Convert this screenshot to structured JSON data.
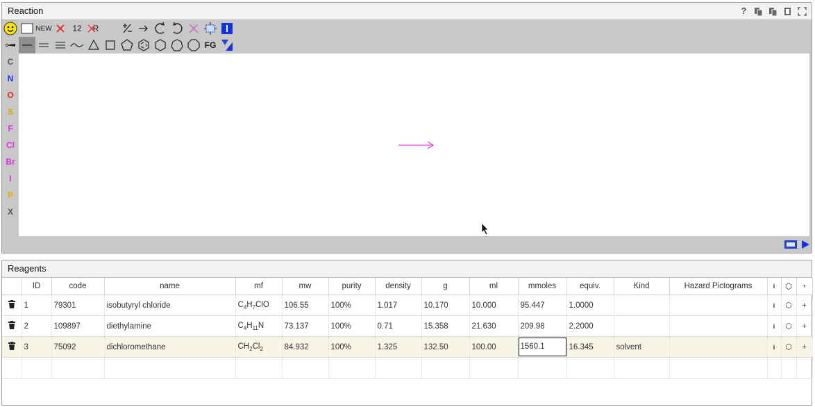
{
  "reaction_panel": {
    "title": "Reaction",
    "toolbar_row1": [
      "smiley",
      "blank",
      "NEW",
      "erase",
      "12",
      "R",
      "empty",
      "charge",
      "arrow",
      "rotate-ccw",
      "rotate-cw",
      "no-stereo",
      "select",
      "info"
    ],
    "new_label": "NEW",
    "num_label": "12",
    "rgroup_label": "R",
    "fg_label": "FG",
    "elements": [
      "C",
      "N",
      "O",
      "S",
      "F",
      "Cl",
      "Br",
      "I",
      "P",
      "X"
    ],
    "colors": {
      "C": "#555555",
      "N": "#2233ee",
      "O": "#ee2222",
      "S": "#c8b400",
      "F": "#dd33dd",
      "Cl": "#dd33dd",
      "Br": "#dd33dd",
      "I": "#dd33dd",
      "P": "#f0b000",
      "X": "#555555",
      "arrow": "#e040e0"
    }
  },
  "reagents_panel": {
    "title": "Reagents",
    "columns": [
      "",
      "ID",
      "code",
      "name",
      "mf",
      "mw",
      "purity",
      "density",
      "g",
      "ml",
      "mmoles",
      "equiv.",
      "Kind",
      "Hazard Pictograms",
      "i",
      "⬡",
      "+"
    ],
    "rows": [
      {
        "id": "1",
        "code": "79301",
        "name": "isobutyryl chloride",
        "mf": [
          "C",
          "4",
          "H",
          "7",
          "ClO"
        ],
        "mw": "106.55",
        "purity": "100%",
        "density": "1.017",
        "g": "10.170",
        "ml": "10.000",
        "mmoles": "95.447",
        "equiv": "1.0000",
        "kind": ""
      },
      {
        "id": "2",
        "code": "109897",
        "name": "diethylamine",
        "mf": [
          "C",
          "4",
          "H",
          "11",
          "N"
        ],
        "mw": "73.137",
        "purity": "100%",
        "density": "0.71",
        "g": "15.358",
        "ml": "21.630",
        "mmoles": "209.98",
        "equiv": "2.2000",
        "kind": ""
      },
      {
        "id": "3",
        "code": "75092",
        "name": "dichloromethane",
        "mf": [
          "CH",
          "2",
          "Cl",
          "2",
          ""
        ],
        "mw": "84.932",
        "purity": "100%",
        "density": "1.325",
        "g": "132.50",
        "ml": "100.00",
        "mmoles": "1560.1",
        "equiv": "16.345",
        "kind": "solvent"
      }
    ]
  }
}
